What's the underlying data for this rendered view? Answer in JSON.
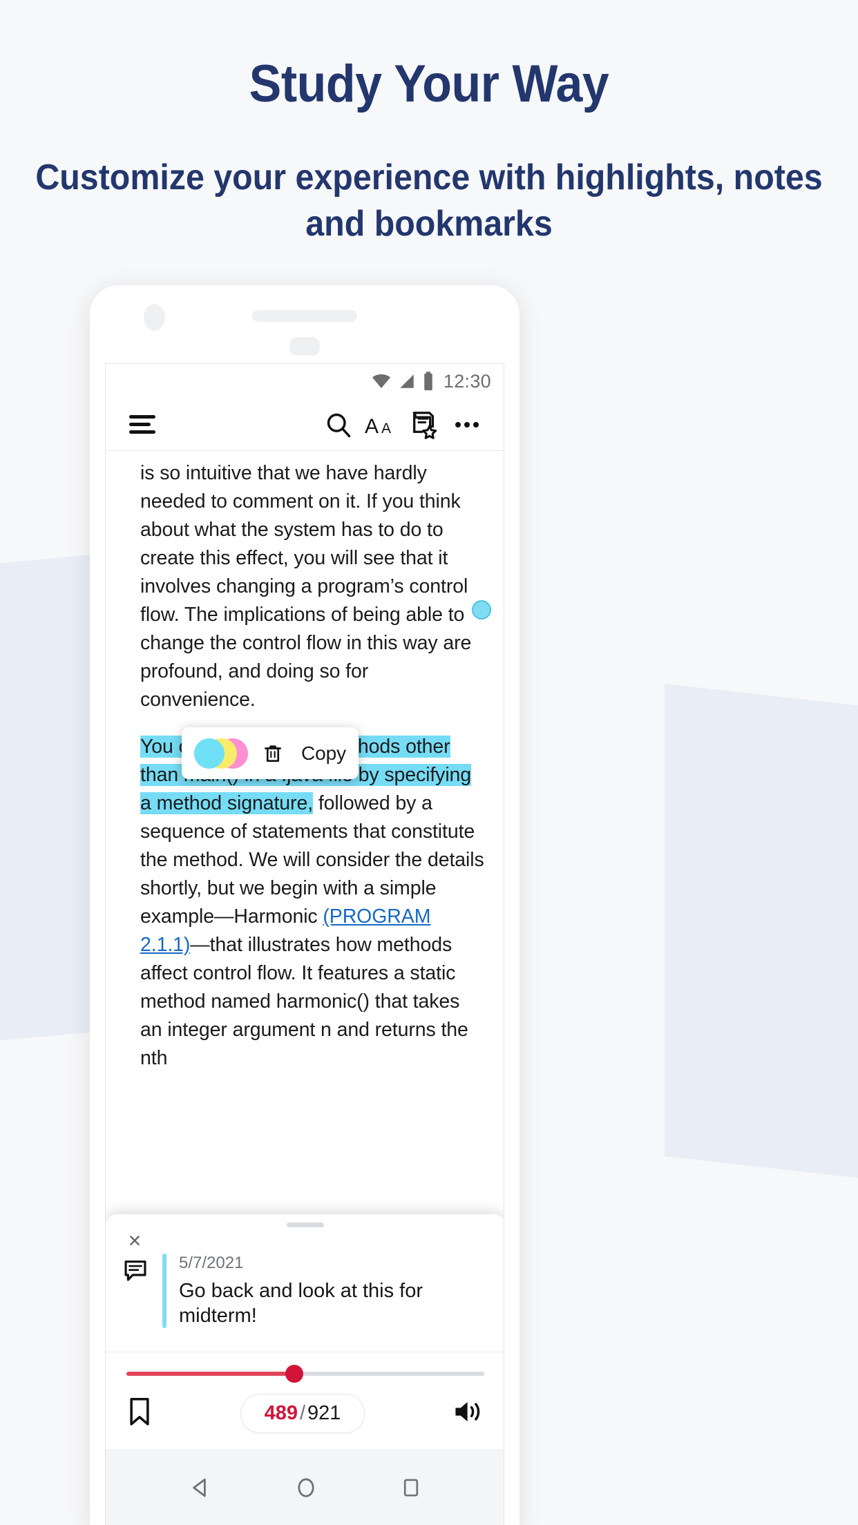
{
  "promo": {
    "title": "Study Your Way",
    "subtitle": "Customize your experience with highlights, notes and bookmarks",
    "title_color": "#23376e",
    "background_color": "#f7f8f9",
    "band_color": "#e6ebf5"
  },
  "status_bar": {
    "time": "12:30",
    "icons": [
      "wifi-icon",
      "cellular-signal-icon",
      "battery-icon"
    ],
    "icon_color": "#6d6d6d"
  },
  "toolbar": {
    "menu_icon": "hamburger-menu-icon",
    "search_icon": "search-icon",
    "font_size_icon": "font-size-icon",
    "annotations_icon": "annotations-list-icon",
    "overflow_icon": "overflow-menu-icon"
  },
  "reader": {
    "paragraph_1_part_1": "is so intuitive that we have hardly needed to comment on it. If you think about what the system has to do to create this effect, you will see that it involves changing a program’s control flow. The implications of being able to change the control flow in this way are profound, and doing so for ",
    "paragraph_1_part_2": "convenience.",
    "highlight_text": "You can define static methods other than main() in a .java file by specifying a method signature,",
    "paragraph_2_after_highlight": " followed by a sequence of statements that constitute the method. We will consider the details shortly, but we begin with a simple example—Harmonic ",
    "link_text": "(PROGRAM 2.1.1)",
    "paragraph_2_tail": "—that illustrates how methods affect control flow. It features a static method named harmonic() that takes an integer argument n and returns the nth",
    "highlight_color": "#76dcf5",
    "link_color": "#1569c7",
    "note_marker_color": "#7fdcf2"
  },
  "selection_popup": {
    "swatch_cyan": "#6fe0f5",
    "swatch_yellow": "#f8ec6a",
    "swatch_pink": "#ff8ed2",
    "color_picker_name": "highlight-color-swatches",
    "delete_icon": "trash-icon",
    "copy_label": "Copy"
  },
  "note_sheet": {
    "close_label": "×",
    "note_icon": "comment-icon",
    "date": "5/7/2021",
    "text": "Go back and look at this for midterm!",
    "accent_color": "#7fdcf2"
  },
  "player": {
    "progress_percent": 47,
    "slider_color": "#e0455c",
    "knob_color": "#d3143a",
    "bookmark_icon": "bookmark-icon",
    "current_page": "489",
    "page_separator": "/",
    "total_pages": "921",
    "audio_icon": "speaker-volume-icon"
  },
  "android_nav": {
    "back_icon": "back-triangle-icon",
    "home_icon": "home-circle-icon",
    "recents_icon": "recents-square-icon",
    "icon_color": "#6e7277"
  }
}
